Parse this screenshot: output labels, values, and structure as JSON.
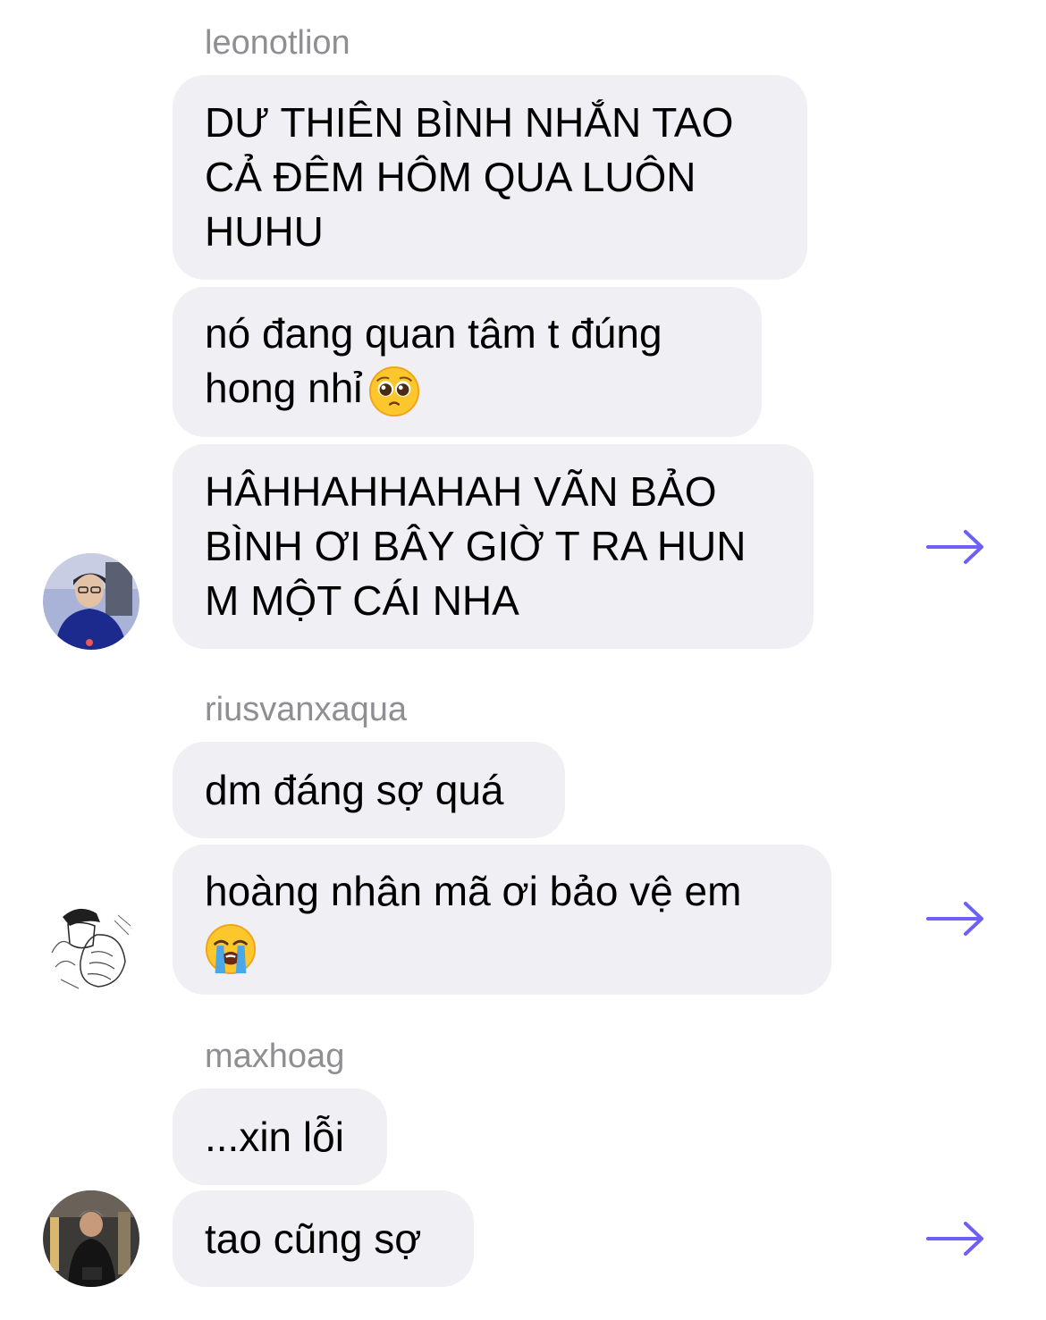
{
  "colors": {
    "bubble": "#efeff4",
    "sender": "#8e8e93",
    "arrow": "#6e5ff5"
  },
  "groups": [
    {
      "sender": "leonotlion",
      "messages": [
        "DƯ THIÊN BÌNH NHẮN TAO CẢ ĐÊM HÔM QUA LUÔN HUHU",
        "nó đang quan tâm t đúng hong nhỉ",
        "HÂHHAHHAHAH VÃN BẢO BÌNH ƠI BÂY GIỜ T RA HUN M MỘT CÁI NHA"
      ],
      "emoji_1": "pleading-face-emoji"
    },
    {
      "sender": "riusvanxaqua",
      "messages": [
        "dm đáng sợ quá",
        "hoàng nhân mã ơi bảo vệ em"
      ],
      "emoji_1": "loudly-crying-face-emoji"
    },
    {
      "sender": "maxhoag",
      "messages": [
        "...xin lỗi",
        "tao cũng sợ"
      ]
    }
  ],
  "icons": {
    "share": "arrow-right-icon",
    "avatar": "user-avatar"
  }
}
